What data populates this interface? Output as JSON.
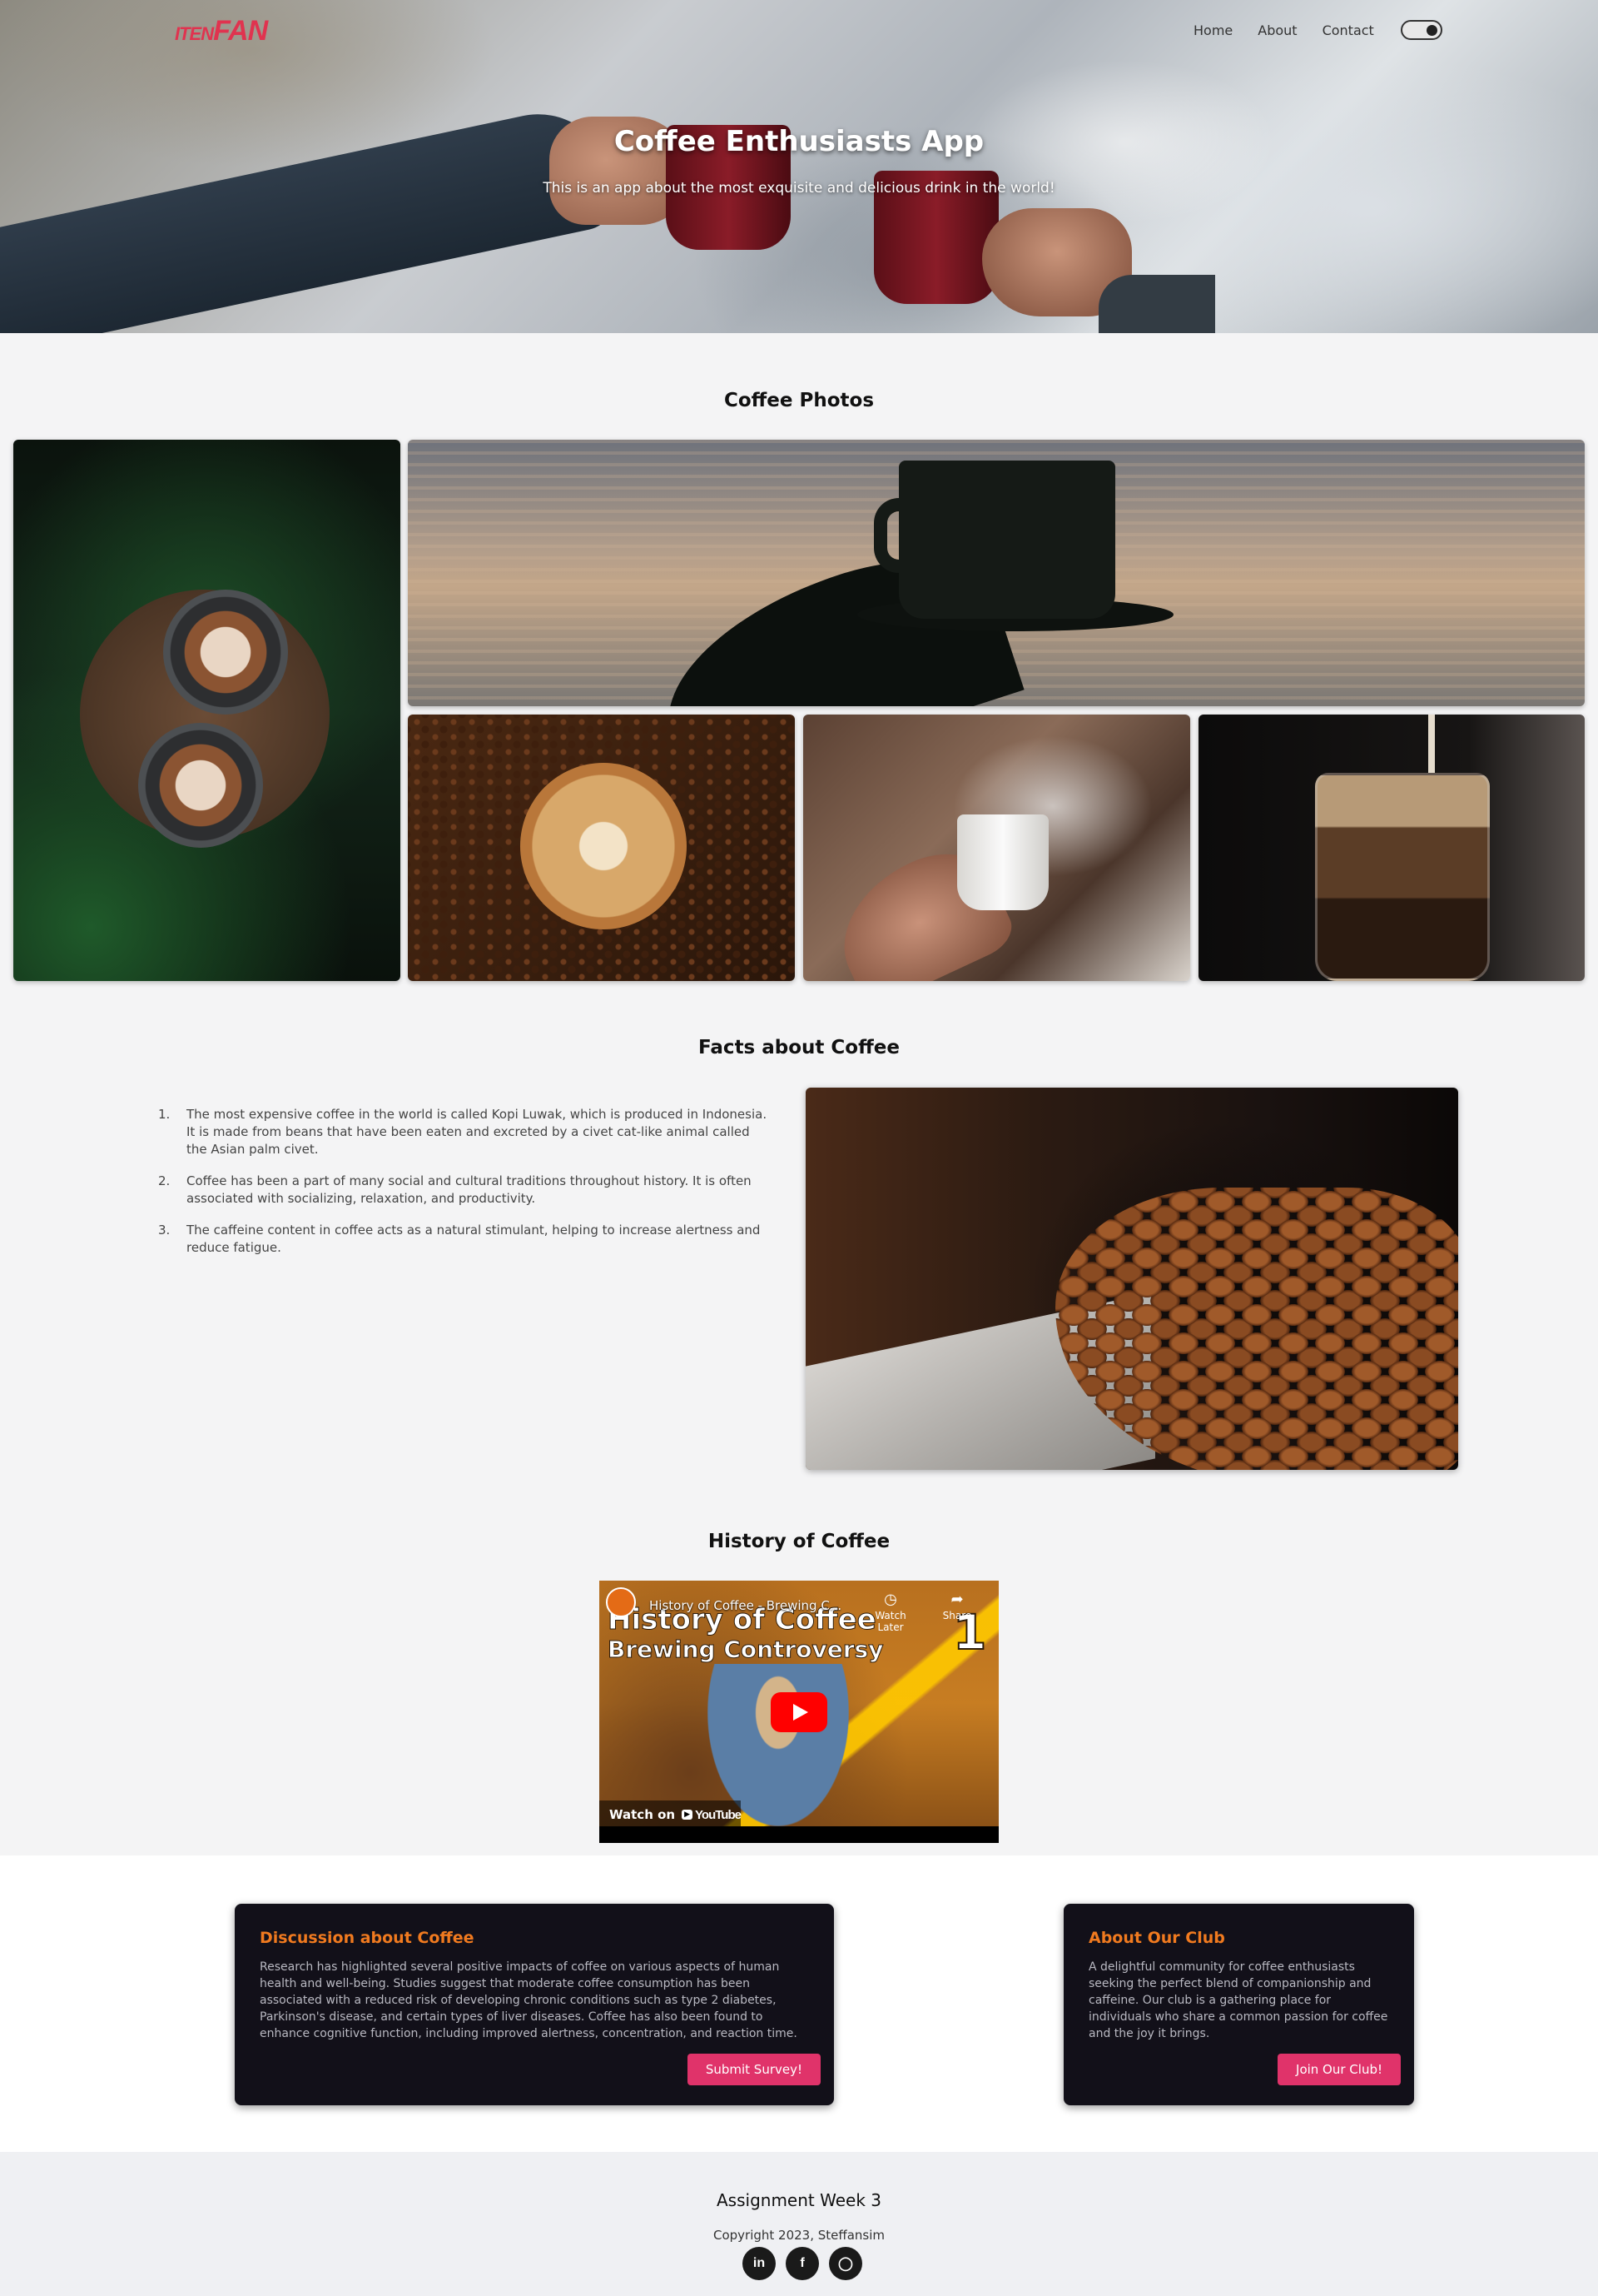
{
  "header": {
    "logo": {
      "prefix": "ITEN",
      "main": "FAN"
    },
    "nav": [
      "Home",
      "About",
      "Contact"
    ],
    "dark_mode_toggle": "on"
  },
  "hero": {
    "title": "Coffee Enthusiasts App",
    "subtitle": "This is an app about the most exquisite and delicious drink in the world!"
  },
  "photos": {
    "title": "Coffee Photos"
  },
  "facts": {
    "title": "Facts about Coffee",
    "items": [
      "The most expensive coffee in the world is called Kopi Luwak, which is produced in Indonesia. It is made from beans that have been eaten and excreted by a civet cat-like animal called the Asian palm civet.",
      "Coffee has been a part of many social and cultural traditions throughout history. It is often associated with socializing, relaxation, and productivity.",
      "The caffeine content in coffee acts as a natural stimulant, helping to increase alertness and reduce fatigue."
    ]
  },
  "history": {
    "title": "History of Coffee",
    "video": {
      "title": "History of Coffee - Brewing C...",
      "thumb_line1": "History of Coffee",
      "thumb_line2": "Brewing Controversy",
      "thumb_number": "1",
      "channel_initial": "E",
      "watch_later": "Watch Later",
      "share": "Share",
      "watch_on": "Watch on",
      "youtube": "YouTube"
    }
  },
  "cards": {
    "discussion": {
      "title": "Discussion about Coffee",
      "text": "Research has highlighted several positive impacts of coffee on various aspects of human health and well-being. Studies suggest that moderate coffee consumption has been associated with a reduced risk of developing chronic conditions such as type 2 diabetes, Parkinson's disease, and certain types of liver diseases. Coffee has also been found to enhance cognitive function, including improved alertness, concentration, and reaction time.",
      "button": "Submit Survey!"
    },
    "club": {
      "title": "About Our Club",
      "text": "A delightful community for coffee enthusiasts seeking the perfect blend of companionship and caffeine. Our club is a gathering place for individuals who share a common passion for coffee and the joy it brings.",
      "button": "Join Our Club!"
    }
  },
  "footer": {
    "title": "Assignment Week 3",
    "copyright": "Copyright 2023, Steffansim",
    "socials": [
      "linkedin-icon",
      "facebook-icon",
      "instagram-icon"
    ]
  },
  "colors": {
    "accent_pink": "#e0336a",
    "card_title_orange": "#f07a1f",
    "card_bg": "#121019",
    "logo_red": "#e0334f"
  }
}
